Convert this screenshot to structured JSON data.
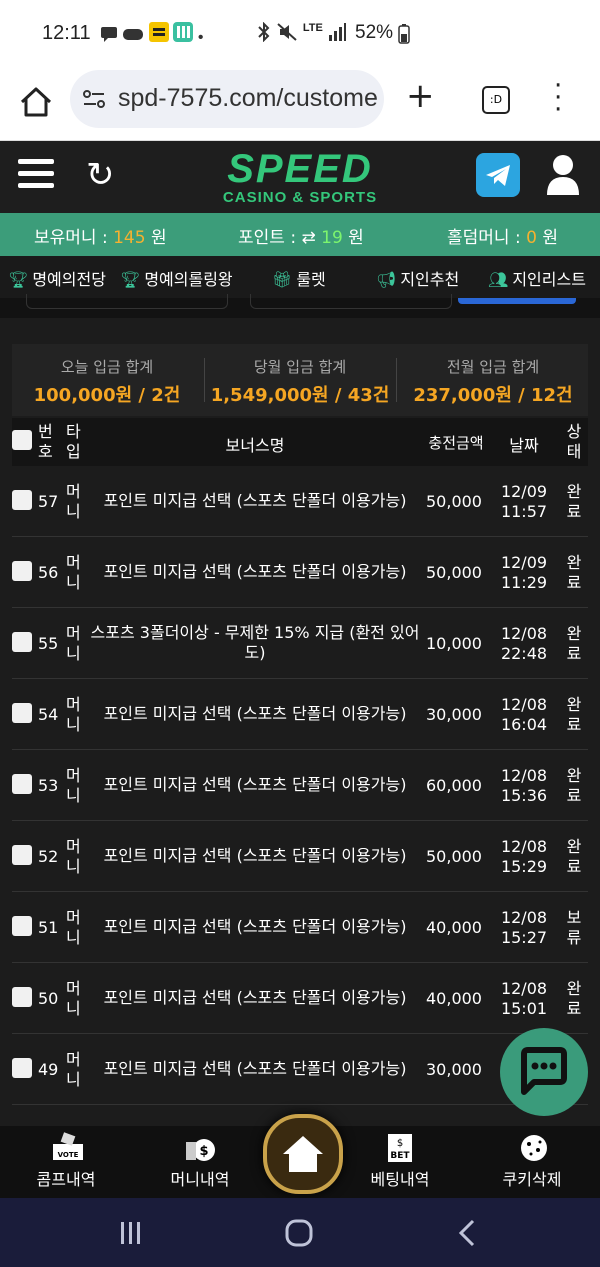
{
  "statusbar": {
    "time": "12:11",
    "battery": "52%",
    "network": "LTE"
  },
  "browser": {
    "url": "spd-7575.com/custome"
  },
  "header": {
    "logo": "SPEED",
    "logo_sub": "CASINO & SPORTS"
  },
  "balance": {
    "money_label": "보유머니 : ",
    "money_value": "145",
    "money_unit": " 원",
    "point_label": "포인트 : ",
    "point_value": "19",
    "point_unit": " 원",
    "holdem_label": "홀덤머니 : ",
    "holdem_value": "0",
    "holdem_unit": " 원"
  },
  "nav": {
    "items": [
      {
        "label": "명예의전당"
      },
      {
        "label": "명예의롤링왕"
      },
      {
        "label": "룰렛"
      },
      {
        "label": "지인추천"
      },
      {
        "label": "지인리스트"
      }
    ]
  },
  "summary": {
    "today_label": "오늘 입금 합계",
    "today_value": "100,000원 / 2건",
    "month_label": "당월 입금 합계",
    "month_value": "1,549,000원 / 43건",
    "last_label": "전월 입금 합계",
    "last_value": "237,000원 / 12건"
  },
  "table": {
    "headers": {
      "no1": "번",
      "no2": "호",
      "type1": "타",
      "type2": "입",
      "name": "보너스명",
      "amount": "충전금액",
      "date": "날짜",
      "status1": "상",
      "status2": "태"
    },
    "rows": [
      {
        "no": "57",
        "t1": "머",
        "t2": "니",
        "name": "포인트 미지급 선택 (스포츠 단폴더 이용가능)",
        "amount": "50,000",
        "d1": "12/09",
        "d2": "11:57",
        "s1": "완",
        "s2": "료"
      },
      {
        "no": "56",
        "t1": "머",
        "t2": "니",
        "name": "포인트 미지급 선택 (스포츠 단폴더 이용가능)",
        "amount": "50,000",
        "d1": "12/09",
        "d2": "11:29",
        "s1": "완",
        "s2": "료"
      },
      {
        "no": "55",
        "t1": "머",
        "t2": "니",
        "name": "스포츠 3폴더이상 - 무제한 15% 지급 (환전 있어도)",
        "amount": "10,000",
        "d1": "12/08",
        "d2": "22:48",
        "s1": "완",
        "s2": "료"
      },
      {
        "no": "54",
        "t1": "머",
        "t2": "니",
        "name": "포인트 미지급 선택 (스포츠 단폴더 이용가능)",
        "amount": "30,000",
        "d1": "12/08",
        "d2": "16:04",
        "s1": "완",
        "s2": "료"
      },
      {
        "no": "53",
        "t1": "머",
        "t2": "니",
        "name": "포인트 미지급 선택 (스포츠 단폴더 이용가능)",
        "amount": "60,000",
        "d1": "12/08",
        "d2": "15:36",
        "s1": "완",
        "s2": "료"
      },
      {
        "no": "52",
        "t1": "머",
        "t2": "니",
        "name": "포인트 미지급 선택 (스포츠 단폴더 이용가능)",
        "amount": "50,000",
        "d1": "12/08",
        "d2": "15:29",
        "s1": "완",
        "s2": "료"
      },
      {
        "no": "51",
        "t1": "머",
        "t2": "니",
        "name": "포인트 미지급 선택 (스포츠 단폴더 이용가능)",
        "amount": "40,000",
        "d1": "12/08",
        "d2": "15:27",
        "s1": "보",
        "s2": "류"
      },
      {
        "no": "50",
        "t1": "머",
        "t2": "니",
        "name": "포인트 미지급 선택 (스포츠 단폴더 이용가능)",
        "amount": "40,000",
        "d1": "12/08",
        "d2": "15:01",
        "s1": "완",
        "s2": "료"
      },
      {
        "no": "49",
        "t1": "머",
        "t2": "니",
        "name": "포인트 미지급 선택 (스포츠 단폴더 이용가능)",
        "amount": "30,000",
        "d1": "",
        "d2": "",
        "s1": "",
        "s2": ""
      }
    ]
  },
  "bottomnav": {
    "comp": "콤프내역",
    "money": "머니내역",
    "betting": "베팅내역",
    "cookie": "쿠키삭제",
    "bet_icon_text": "BET",
    "vote_icon_text": "VOTE"
  }
}
